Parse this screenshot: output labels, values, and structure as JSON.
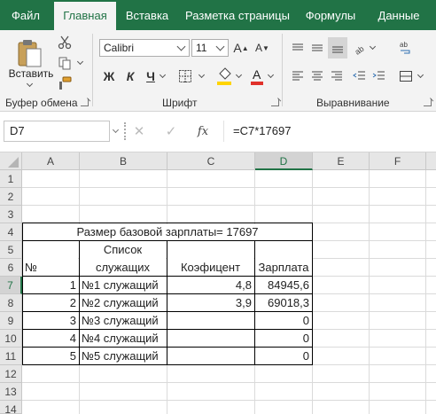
{
  "tabs": [
    {
      "label": "Файл"
    },
    {
      "label": "Главная"
    },
    {
      "label": "Вставка"
    },
    {
      "label": "Разметка страницы"
    },
    {
      "label": "Формулы"
    },
    {
      "label": "Данные"
    }
  ],
  "ribbon": {
    "clipboard": {
      "label": "Буфер обмена",
      "paste_label": "Вставить"
    },
    "font": {
      "label": "Шрифт",
      "name": "Calibri",
      "size": "11",
      "bold": "Ж",
      "italic": "К",
      "underline": "Ч",
      "font_color": "#e0312a",
      "fill_color": "#ffd400"
    },
    "alignment": {
      "label": "Выравнивание"
    }
  },
  "formula_bar": {
    "cell_ref": "D7",
    "fx": "fx",
    "formula": "=C7*17697"
  },
  "columns": [
    "A",
    "B",
    "C",
    "D",
    "E",
    "F"
  ],
  "rows": [
    "1",
    "2",
    "3",
    "4",
    "5",
    "6",
    "7",
    "8",
    "9",
    "10",
    "11",
    "12",
    "13",
    "14"
  ],
  "sheet": {
    "title": "Размер базовой зарплаты= 17697",
    "header": {
      "no": "№",
      "list_1": "Список",
      "list_2": "служащих",
      "coef": "Коэфицент",
      "salary": "Зарплата"
    },
    "employees": [
      {
        "no": "1",
        "name": "№1 служащий",
        "coef": "4,8",
        "salary": "84945,6"
      },
      {
        "no": "2",
        "name": "№2 служащий",
        "coef": "3,9",
        "salary": "69018,3"
      },
      {
        "no": "3",
        "name": "№3 служащий",
        "coef": "",
        "salary": "0"
      },
      {
        "no": "4",
        "name": "№4 служащий",
        "coef": "",
        "salary": "0"
      },
      {
        "no": "5",
        "name": "№5 служащий",
        "coef": "",
        "salary": "0"
      }
    ]
  }
}
